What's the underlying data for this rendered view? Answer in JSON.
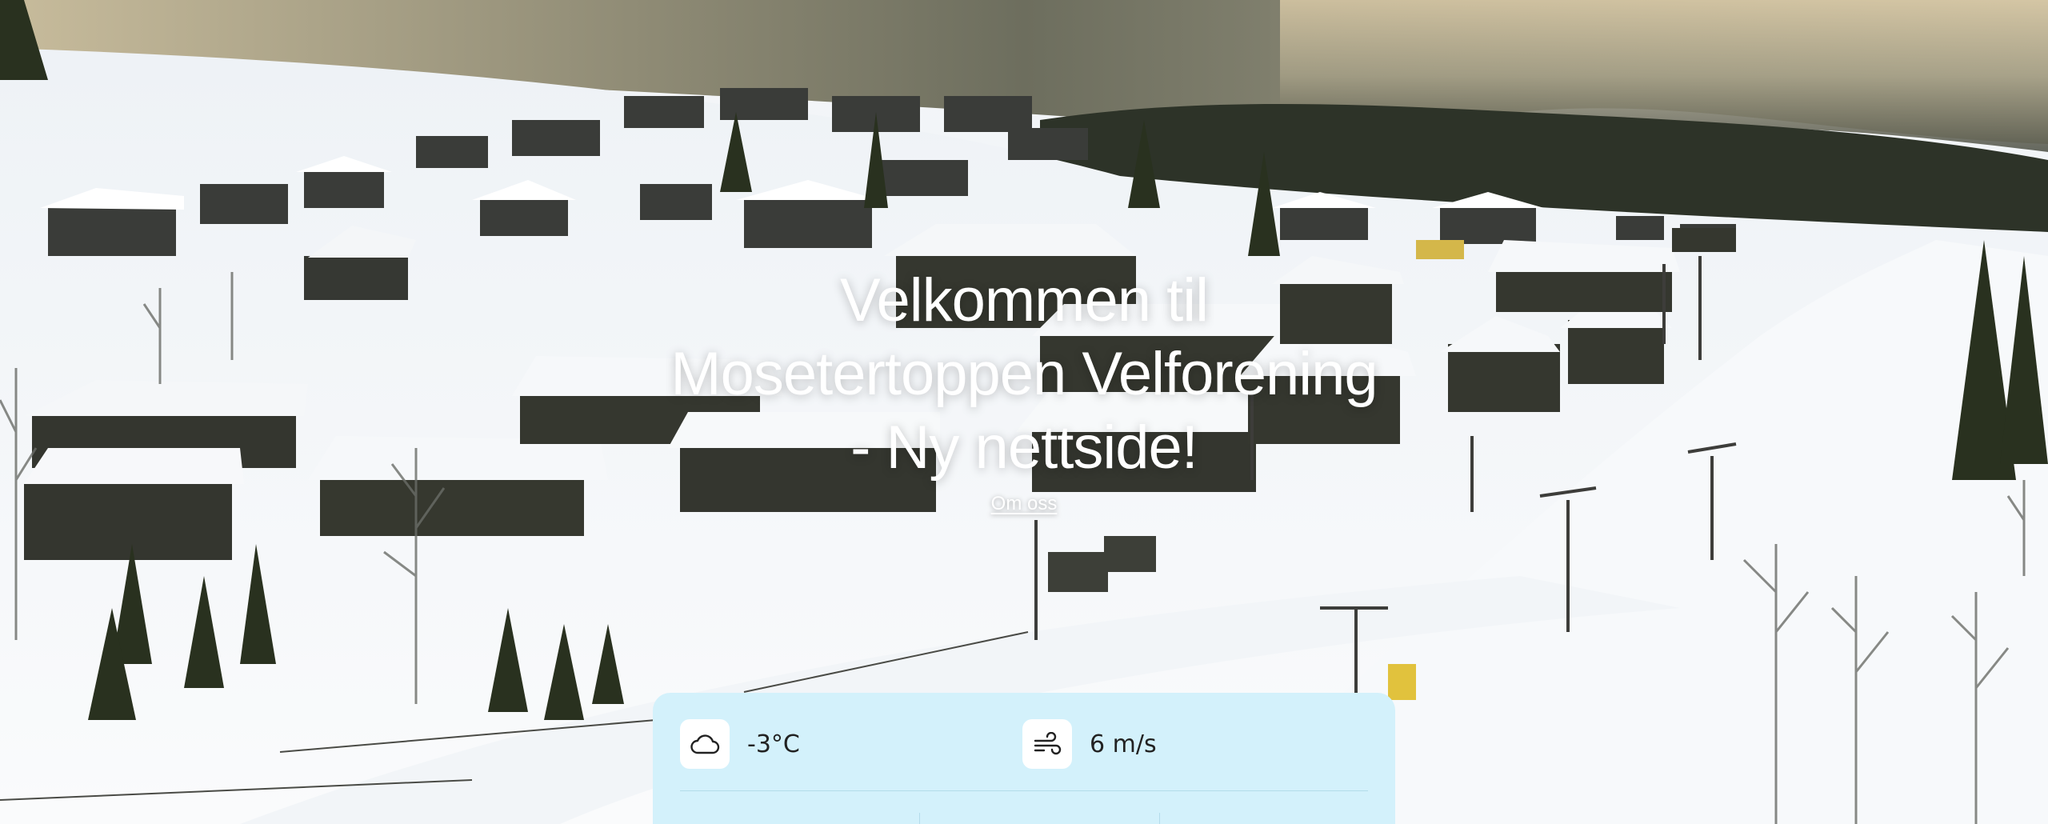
{
  "hero": {
    "title_line1": "Velkommen til",
    "title_line2": "Mosetertoppen Velforening",
    "title_line3": "- Ny nettside!",
    "link_label": "Om oss"
  },
  "weather": {
    "temperature": "-3°C",
    "temperature_icon": "cloud-icon",
    "wind": "6 m/s",
    "wind_icon": "wind-icon",
    "sub_values": [
      "",
      "",
      ""
    ]
  },
  "colors": {
    "card_bg": "#d3f1fb",
    "text_white": "#ffffff"
  }
}
